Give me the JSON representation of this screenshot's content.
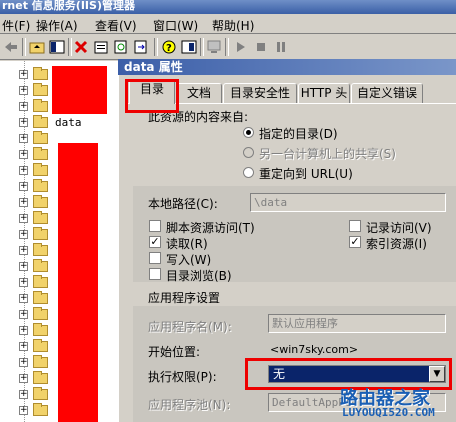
{
  "window": {
    "title": "rnet 信息服务(IIS)管理器"
  },
  "menu": {
    "items": [
      "件(F)",
      "操作(A)",
      "查看(V)",
      "窗口(W)",
      "帮助(H)"
    ]
  },
  "tree": {
    "visible_label": "data"
  },
  "dialog": {
    "title": "data 属性",
    "tabs": [
      "目录",
      "文档",
      "目录安全性",
      "HTTP 头",
      "自定义错误"
    ],
    "content_source_label": "此资源的内容来自:",
    "radio_options": [
      "指定的目录(D)",
      "另一台计算机上的共享(S)",
      "重定向到 URL(U)"
    ],
    "local_path_label": "本地路径(C):",
    "local_path_value": "\\data",
    "checkboxes_left": [
      {
        "label": "脚本资源访问(T)",
        "checked": false
      },
      {
        "label": "读取(R)",
        "checked": true
      },
      {
        "label": "写入(W)",
        "checked": false
      },
      {
        "label": "目录浏览(B)",
        "checked": false
      }
    ],
    "checkboxes_right": [
      {
        "label": "记录访问(V)",
        "checked": false
      },
      {
        "label": "索引资源(I)",
        "checked": true
      }
    ],
    "app_settings_label": "应用程序设置",
    "app_name_label": "应用程序名(M):",
    "app_name_value": "默认应用程序",
    "start_pos_label": "开始位置:",
    "start_pos_value": "<win7sky.com>",
    "exec_perm_label": "执行权限(P):",
    "exec_perm_value": "无",
    "app_pool_label": "应用程序池(N):",
    "app_pool_value": "DefaultAppPool"
  },
  "watermark": {
    "top": "路由器之家",
    "bottom": "LUYOUQI520.COM"
  },
  "colors": {
    "highlight_red": "#e00000",
    "redaction": "#ff0000",
    "title_blue": "#3b5ea8",
    "select_bg": "#0a246a"
  }
}
